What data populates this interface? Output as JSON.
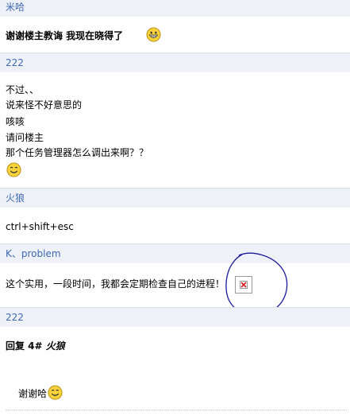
{
  "posts": [
    {
      "author": "米哈",
      "lines": [
        "谢谢楼主教诲  我现在晓得了"
      ]
    },
    {
      "author": "222",
      "lines": [
        "不过、、",
        "说来怪不好意思的",
        "咳咳",
        "请问楼主",
        "那个任务管理器怎么调出来啊？？"
      ]
    },
    {
      "author": "火狼",
      "lines": [
        "ctrl+shift+esc"
      ]
    },
    {
      "author": "K、problem",
      "lines": [
        "这个实用，一段时间，我都会定期检查自己的进程！"
      ]
    },
    {
      "author": "222",
      "reply_prefix": "回复  4# ",
      "reply_target": "火狼",
      "lines": [
        "谢谢哈"
      ]
    }
  ],
  "icons": {
    "grin": "grin-smiley-icon",
    "smile": "smile-smiley-icon",
    "broken_image": "broken-image-icon"
  },
  "colors": {
    "author_link": "#3f68b1",
    "author_bar_bg": "#eef2f8",
    "annotation_circle": "#1a1a9a",
    "smiley_fill": "#f7d23b"
  }
}
